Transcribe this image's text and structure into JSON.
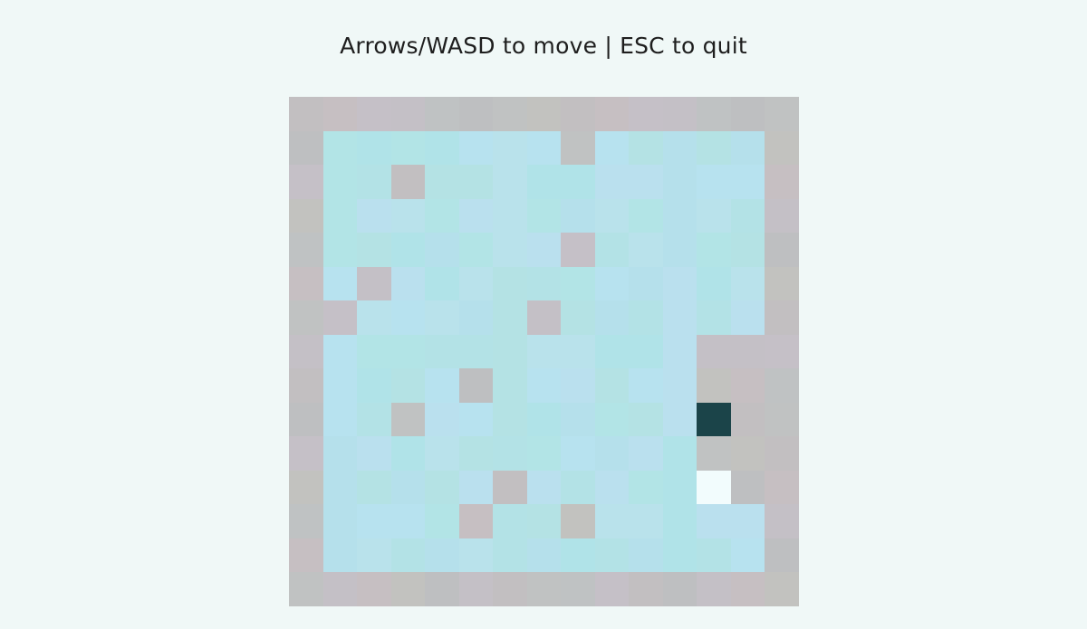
{
  "hud": {
    "instructions": "Arrows/WASD to move | ESC to quit"
  },
  "game": {
    "grid_size": 15,
    "legend": {
      "W": "wall",
      "F": "floor",
      "P": "player",
      "G": "goal"
    },
    "palette": {
      "wall": [
        "#c2bfc1",
        "#c4c0c6",
        "#c0c2c2",
        "#c6bfc2",
        "#bfc2c3",
        "#c2c2bf",
        "#c5c0c7",
        "#bebfc1"
      ],
      "floor": [
        "#b3e2e6",
        "#b5e0eb",
        "#b9e2eb",
        "#b2e4e6",
        "#bae0ee",
        "#b4e2e4",
        "#b7e2ef",
        "#b0e3e8"
      ],
      "player": "#1b4449",
      "goal": "#f2fcfd"
    },
    "map": [
      "WWWWWWWWWWWWWWW",
      "WFFFFFFFWFFFFFW",
      "WFFWFFFFFFFFFFW",
      "WFFFFFFFFFFFFFW",
      "WFFFFFFFWFFFFFW",
      "WFWFFFFFFFFFFFW",
      "WWFFFFFWFFFFFFW",
      "WFFFFFFFFFFFWWW",
      "WFFFFWFFFFFFWWW",
      "WFFWFFFFFFFFPWW",
      "WFFFFFFFFFFFWWW",
      "WFFFFFWFFFFFGWW",
      "WFFFFWFFWFFFFFW",
      "WFFFFFFFFFFFFFW",
      "WWWWWWWWWWWWWWW"
    ]
  }
}
